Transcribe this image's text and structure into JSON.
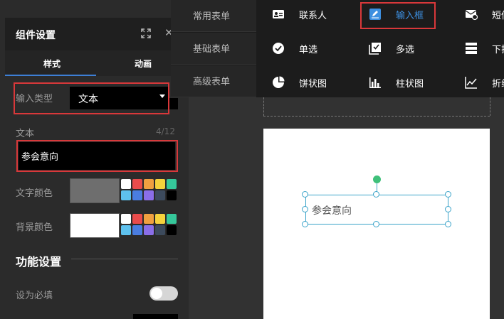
{
  "panel": {
    "title": "组件设置",
    "tabs": [
      "样式",
      "动画"
    ],
    "input_type_label": "输入类型",
    "input_type_value": "文本",
    "text_label": "文本",
    "text_count": "4/12",
    "text_value": "参会意向",
    "text_color_label": "文字颜色",
    "bg_color_label": "背景颜色",
    "function_title": "功能设置",
    "required_label": "设为必填"
  },
  "colors": {
    "text_color_current": "#6e6e6e",
    "bg_color_current": "#ffffff",
    "palette": [
      "#ffffff",
      "#e94b4b",
      "#f0a040",
      "#f5d23c",
      "#35c79a",
      "#5ec1ee",
      "#4a7de0",
      "#8a6ee8",
      "#3c4a5c",
      "#000000"
    ],
    "accent": "#3d8fe0",
    "highlight": "#d9383a"
  },
  "canvas": {
    "element_text": "参会意向"
  },
  "menu": {
    "categories": [
      "常用表单",
      "基础表单",
      "高级表单"
    ],
    "rows": [
      [
        {
          "label": "联系人",
          "icon": "contact-card-icon"
        },
        {
          "label": "输入框",
          "icon": "edit-pen-icon",
          "active": true
        },
        {
          "label": "短信",
          "icon": "sms-icon"
        }
      ],
      [
        {
          "label": "单选",
          "icon": "radio-check-icon"
        },
        {
          "label": "多选",
          "icon": "checkbox-icon"
        },
        {
          "label": "下拉",
          "icon": "dropdown-list-icon"
        }
      ],
      [
        {
          "label": "饼状图",
          "icon": "pie-chart-icon"
        },
        {
          "label": "柱状图",
          "icon": "bar-chart-icon"
        },
        {
          "label": "折线",
          "icon": "line-chart-icon"
        }
      ]
    ]
  }
}
